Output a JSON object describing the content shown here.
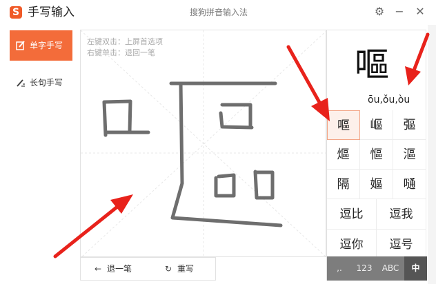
{
  "titlebar": {
    "logo_letter": "S",
    "app_title": "手写输入",
    "window_title": "搜狗拼音输入法",
    "settings_icon": "gear-icon",
    "minimize_icon": "minus-icon",
    "close_icon": "close-icon"
  },
  "sidebar": {
    "items": [
      {
        "label": "单字手写",
        "icon": "pen-icon",
        "active": true
      },
      {
        "label": "长句手写",
        "icon": "pen-lines-icon",
        "active": false
      }
    ]
  },
  "canvas": {
    "hints": [
      "左键双击：上屏首选项",
      "右键单击：退回一笔"
    ]
  },
  "bottom_bar": {
    "undo_label": "退一笔",
    "undo_icon": "arrow-left-icon",
    "rewrite_label": "重写",
    "rewrite_icon": "refresh-icon"
  },
  "candidates": {
    "preview_char": "嘔",
    "pinyin": "ōu,ǒu,òu",
    "grid": [
      "嘔",
      "嶇",
      "彄",
      "熰",
      "慪",
      "漚",
      "隔",
      "嫗",
      "嗵"
    ],
    "words": [
      "逗比",
      "逗我",
      "逗你",
      "逗号"
    ]
  },
  "modes": [
    {
      "label": ",.",
      "selected": false
    },
    {
      "label": "123",
      "selected": false
    },
    {
      "label": "ABC",
      "selected": false
    },
    {
      "label": "中",
      "selected": true
    }
  ],
  "colors": {
    "accent": "#f36c3a",
    "annotation_arrow": "#e8221b",
    "stroke": "#6e6e6e"
  }
}
